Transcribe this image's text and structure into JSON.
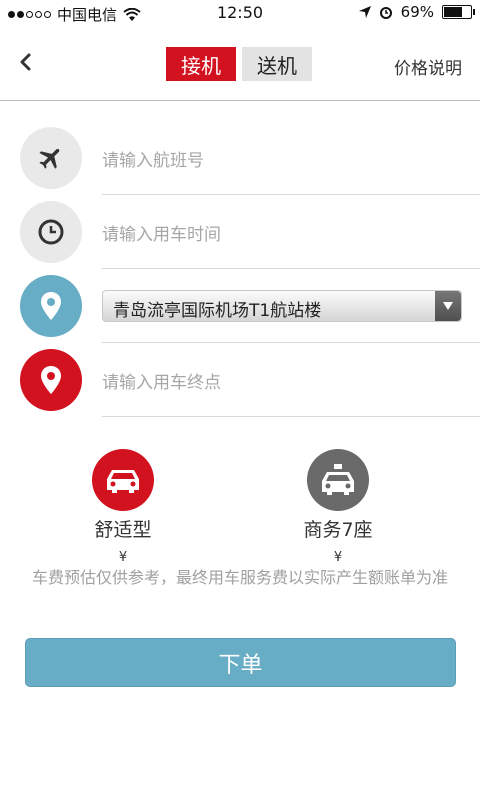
{
  "status_bar": {
    "carrier": "中国电信",
    "time": "12:50",
    "battery": "69%"
  },
  "nav": {
    "tabs": [
      {
        "label": "接机",
        "active": true
      },
      {
        "label": "送机",
        "active": false
      }
    ],
    "price_help": "价格说明"
  },
  "form": {
    "flight_placeholder": "请输入航班号",
    "time_placeholder": "请输入用车时间",
    "pickup_location": "青岛流亭国际机场T1航站楼",
    "destination_placeholder": "请输入用车终点"
  },
  "car_types": [
    {
      "name": "舒适型",
      "price": "¥",
      "color": "#d3121f",
      "icon": "car-icon"
    },
    {
      "name": "商务7座",
      "price": "¥",
      "color": "#6a6a6a",
      "icon": "taxi-icon"
    }
  ],
  "note": "车费预估仅供参考，最终用车服务费以实际产生额账单为准",
  "submit_label": "下单",
  "colors": {
    "accent_red": "#d3121f",
    "accent_blue": "#67adc5",
    "placeholder": "#a6a6a6"
  }
}
